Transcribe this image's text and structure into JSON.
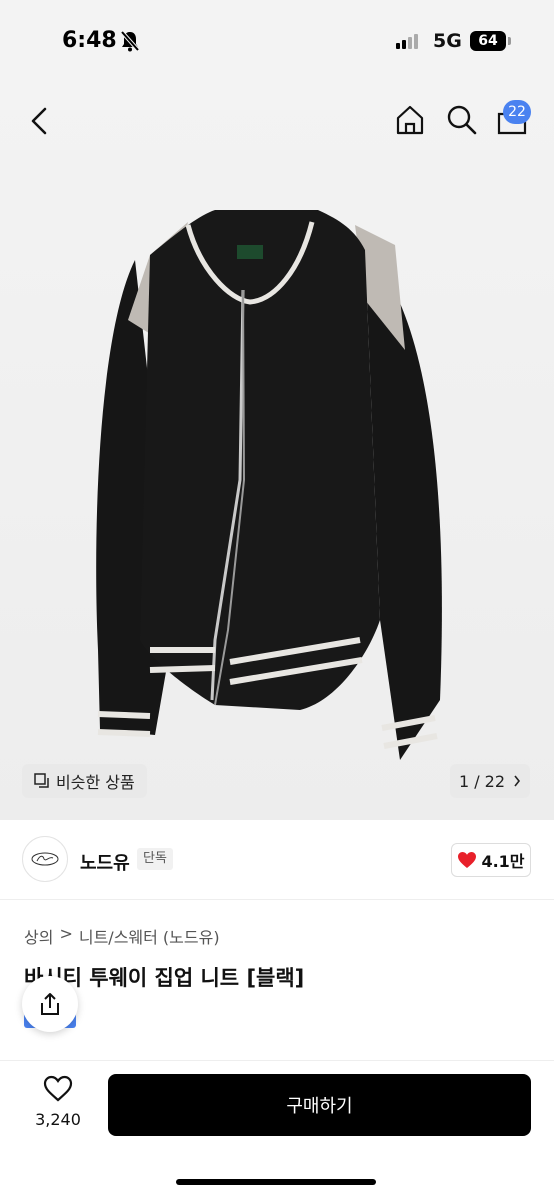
{
  "status": {
    "time": "6:48",
    "network": "5G",
    "battery": "64"
  },
  "header": {
    "cart_count": "22"
  },
  "image": {
    "similar_label": "비슷한 상품",
    "counter": "1 / 22"
  },
  "brand": {
    "name": "노드유",
    "badge": "단독",
    "likes": "4.1만"
  },
  "breadcrumb": {
    "level1": "상의",
    "separator": ">",
    "level2": "니트/스웨터 (노드유)"
  },
  "product": {
    "title": "바시티 투웨이 집업 니트 [블랙]"
  },
  "bottom": {
    "wish_count": "3,240",
    "buy_label": "구매하기"
  },
  "colors": {
    "accent": "#4a82f0",
    "buy": "#000000",
    "heart": "#e8202a"
  }
}
